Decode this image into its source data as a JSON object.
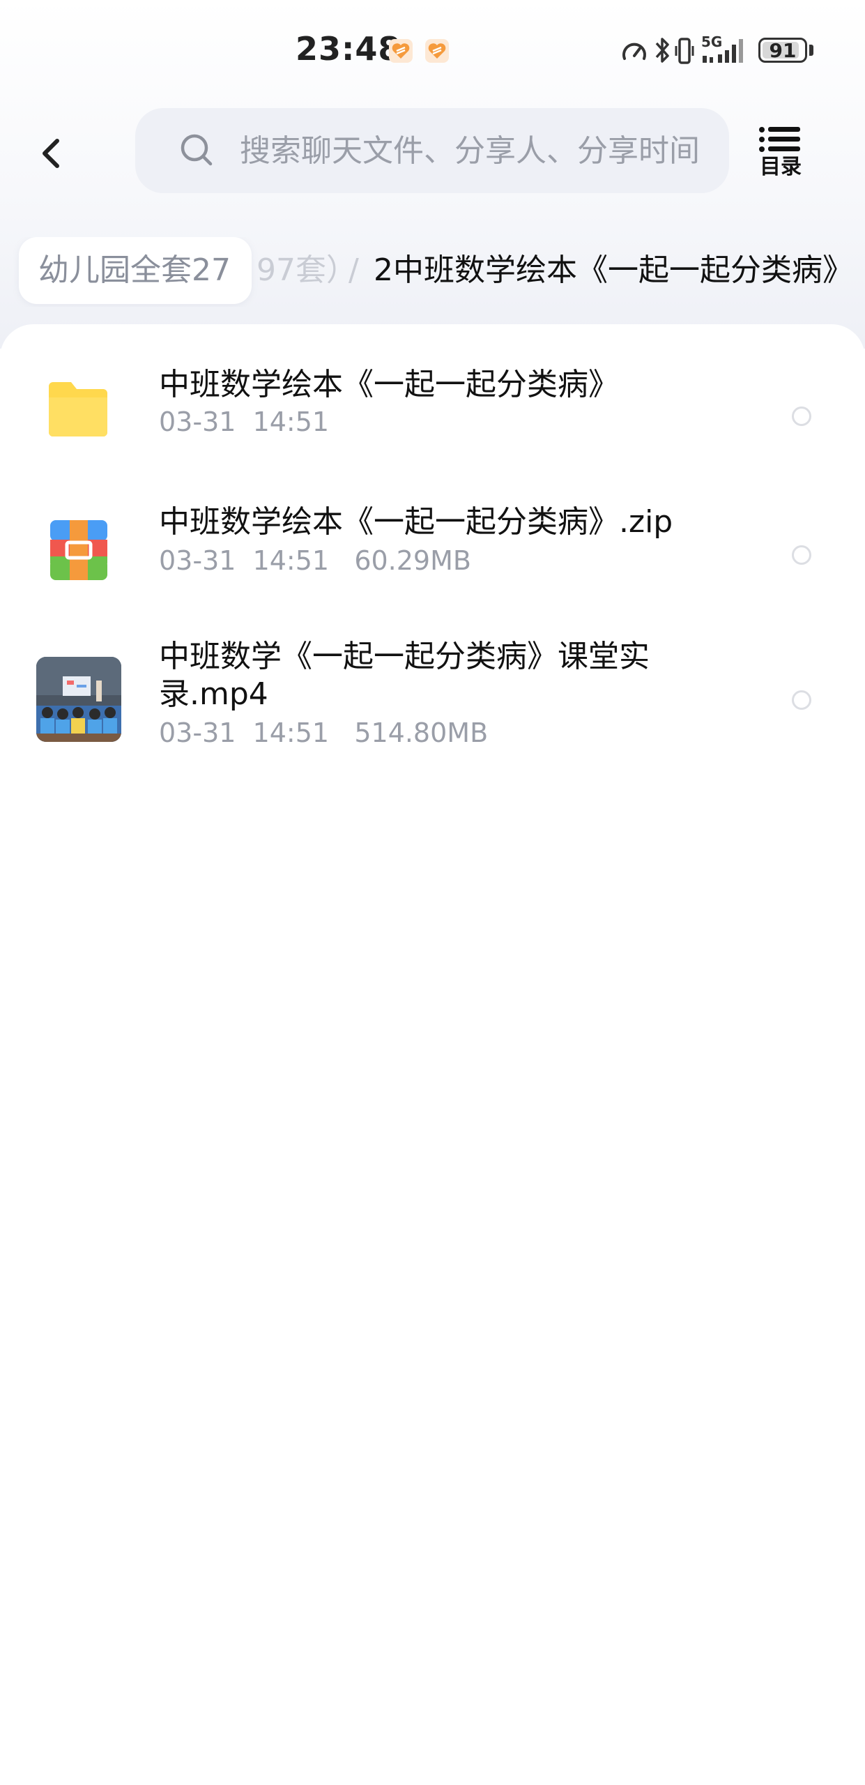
{
  "status_bar": {
    "time": "23:48",
    "network": "5G",
    "battery": "91",
    "battery_level_percent": 91
  },
  "header": {
    "search_placeholder": "搜索聊天文件、分享人、分享时间",
    "toc_label": "目录"
  },
  "breadcrumb": {
    "root": "幼儿园全套27",
    "hidden": "97套）",
    "separator": "/",
    "current": "2中班数学绘本《一起一起分类病》"
  },
  "files": [
    {
      "name": "中班数学绘本《一起一起分类病》",
      "meta": "03-31  14:51",
      "icon": "folder-icon"
    },
    {
      "name": "中班数学绘本《一起一起分类病》.zip",
      "meta": "03-31  14:51   60.29MB",
      "icon": "zip-archive-icon"
    },
    {
      "name": "中班数学《一起一起分类病》课堂实录.mp4",
      "meta": "03-31  14:51   514.80MB",
      "icon": "video-thumbnail"
    }
  ],
  "colors": {
    "folder": "#FFD84D",
    "accent_orange": "#F59A3C",
    "zip_blue": "#4A9DF5",
    "zip_red": "#F0574E",
    "zip_green": "#6CC24A",
    "muted_text": "#9A9EA8",
    "search_bg": "#EEF0F6"
  }
}
